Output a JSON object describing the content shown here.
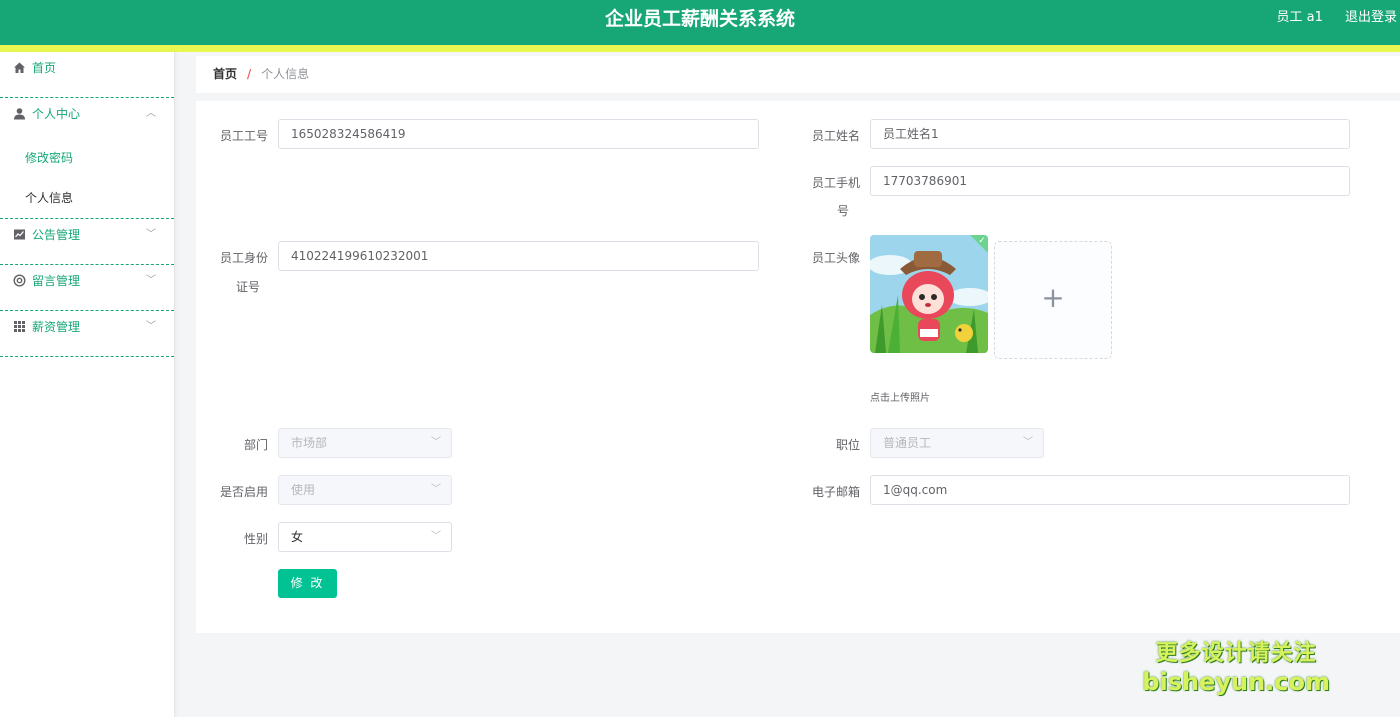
{
  "header": {
    "title": "企业员工薪酬关系系统",
    "user": "员工 a1",
    "logout": "退出登录"
  },
  "sidebar": {
    "home": "首页",
    "personal_center": "个人中心",
    "sub_change_password": "修改密码",
    "sub_personal_info": "个人信息",
    "notice_mgmt": "公告管理",
    "message_mgmt": "留言管理",
    "salary_mgmt": "薪资管理"
  },
  "breadcrumb": {
    "home": "首页",
    "separator": "/",
    "current": "个人信息"
  },
  "form": {
    "emp_id_label": "员工工号",
    "emp_id_value": "165028324586419",
    "emp_name_label": "员工姓名",
    "emp_name_value": "员工姓名1",
    "phone_label_1": "员工手机",
    "phone_label_2": "号",
    "phone_value": "17703786901",
    "idcard_label_1": "员工身份",
    "idcard_label_2": "证号",
    "idcard_value": "410224199610232001",
    "avatar_label": "员工头像",
    "upload_hint": "点击上传照片",
    "dept_label": "部门",
    "dept_value": "市场部",
    "position_label": "职位",
    "position_value": "普通员工",
    "enabled_label": "是否启用",
    "enabled_value": "使用",
    "email_label": "电子邮箱",
    "email_value": "1@qq.com",
    "gender_label": "性别",
    "gender_value": "女",
    "submit_label": "修 改"
  },
  "watermark": {
    "line1": "更多设计请关注",
    "line2": "bisheyun.com"
  },
  "colors": {
    "primary": "#17a776",
    "accent_strip": "#eaf750",
    "button": "#00c292"
  }
}
